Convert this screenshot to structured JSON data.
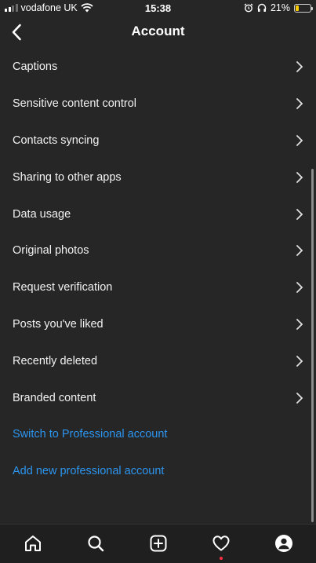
{
  "status_bar": {
    "carrier": "vodafone UK",
    "time": "15:38",
    "battery_percent": "21%",
    "battery_level": 0.21,
    "icons": [
      "signal-icon",
      "wifi-icon",
      "alarm-icon",
      "headphones-icon",
      "battery-icon"
    ]
  },
  "header": {
    "title": "Account",
    "back_icon": "chevron-left-icon"
  },
  "menu": {
    "items": [
      {
        "label": "Captions"
      },
      {
        "label": "Sensitive content control"
      },
      {
        "label": "Contacts syncing"
      },
      {
        "label": "Sharing to other apps"
      },
      {
        "label": "Data usage"
      },
      {
        "label": "Original photos"
      },
      {
        "label": "Request verification"
      },
      {
        "label": "Posts you've liked"
      },
      {
        "label": "Recently deleted"
      },
      {
        "label": "Branded content"
      }
    ],
    "links": [
      {
        "label": "Switch to Professional account"
      },
      {
        "label": "Add new professional account"
      }
    ]
  },
  "tab_bar": {
    "tabs": [
      "home-icon",
      "search-icon",
      "add-post-icon",
      "activity-heart-icon",
      "profile-icon"
    ]
  },
  "colors": {
    "background": "#262626",
    "text": "#f5f5f5",
    "link": "#2c95ef",
    "battery_fill": "#ffcc00",
    "notification_dot": "#ff3040"
  }
}
